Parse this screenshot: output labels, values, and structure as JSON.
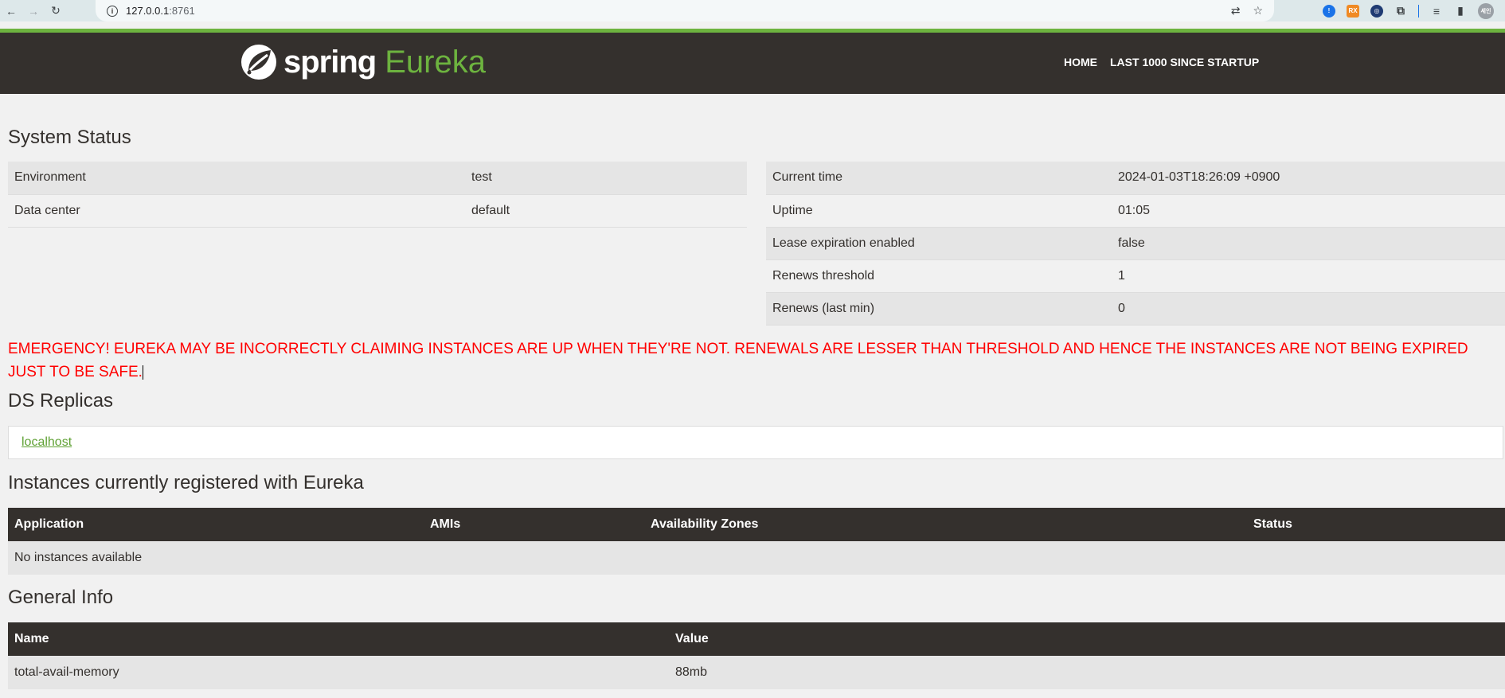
{
  "browser": {
    "url_host": "127.0.0.1",
    "url_port": ":8761",
    "profile_label": "세인"
  },
  "navbar": {
    "brand_spring": "spring",
    "brand_eureka": "Eureka",
    "links": [
      "HOME",
      "LAST 1000 SINCE STARTUP"
    ]
  },
  "system_status": {
    "title": "System Status",
    "left": [
      {
        "label": "Environment",
        "value": "test"
      },
      {
        "label": "Data center",
        "value": "default"
      }
    ],
    "right": [
      {
        "label": "Current time",
        "value": "2024-01-03T18:26:09 +0900"
      },
      {
        "label": "Uptime",
        "value": "01:05"
      },
      {
        "label": "Lease expiration enabled",
        "value": "false"
      },
      {
        "label": "Renews threshold",
        "value": "1"
      },
      {
        "label": "Renews (last min)",
        "value": "0"
      }
    ]
  },
  "emergency": "EMERGENCY! EUREKA MAY BE INCORRECTLY CLAIMING INSTANCES ARE UP WHEN THEY'RE NOT. RENEWALS ARE LESSER THAN THRESHOLD AND HENCE THE INSTANCES ARE NOT BEING EXPIRED JUST TO BE SAFE.",
  "ds_replicas": {
    "title": "DS Replicas",
    "link": "localhost"
  },
  "instances": {
    "title": "Instances currently registered with Eureka",
    "headers": [
      "Application",
      "AMIs",
      "Availability Zones",
      "Status"
    ],
    "empty_text": "No instances available"
  },
  "general_info": {
    "title": "General Info",
    "headers": [
      "Name",
      "Value"
    ],
    "rows": [
      {
        "name": "total-avail-memory",
        "value": "88mb"
      }
    ]
  }
}
